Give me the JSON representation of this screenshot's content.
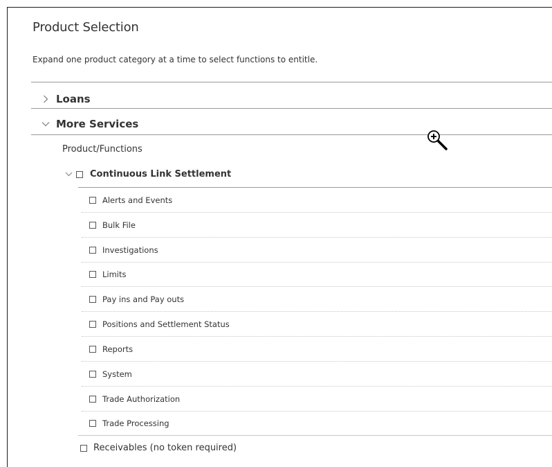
{
  "page": {
    "title": "Product Selection",
    "description": "Expand one product category at a time to select functions to entitle."
  },
  "categories": [
    {
      "label": "Loans",
      "expanded": false
    },
    {
      "label": "More Services",
      "expanded": true
    }
  ],
  "product_functions_label": "Product/Functions",
  "product": {
    "label": "Continuous Link Settlement",
    "expanded": true,
    "checked": false
  },
  "functions": [
    {
      "label": "Alerts and Events",
      "checked": false
    },
    {
      "label": "Bulk File",
      "checked": false
    },
    {
      "label": "Investigations",
      "checked": false
    },
    {
      "label": "Limits",
      "checked": false
    },
    {
      "label": "Pay ins and Pay outs",
      "checked": false
    },
    {
      "label": "Positions and Settlement Status",
      "checked": false
    },
    {
      "label": "Reports",
      "checked": false
    },
    {
      "label": "System",
      "checked": false
    },
    {
      "label": "Trade Authorization",
      "checked": false
    },
    {
      "label": "Trade Processing",
      "checked": false
    }
  ],
  "receivables": {
    "label": "Receivables (no token required)",
    "checked": false
  },
  "icons": {
    "collapsed": "chevron-right-icon",
    "expanded": "chevron-down-icon",
    "cursor": "zoom-in-cursor-icon"
  }
}
